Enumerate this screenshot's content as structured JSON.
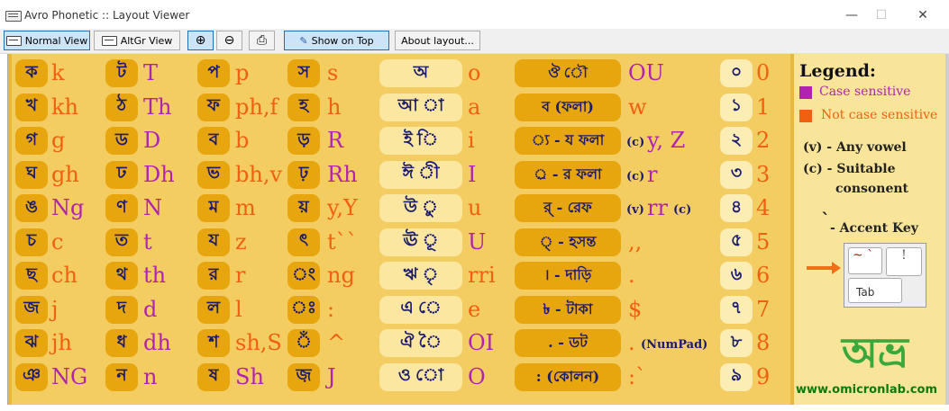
{
  "window": {
    "title": "Avro Phonetic :: Layout Viewer",
    "minimize": "—",
    "maximize": "☐",
    "close": "✕"
  },
  "toolbar": {
    "normal_view": "Normal View",
    "altgr_view": "AltGr View",
    "zoom_in": "⊕",
    "zoom_out": "⊖",
    "print": "⎙",
    "show_on_top": "Show on Top",
    "about": "About layout..."
  },
  "consonants": [
    {
      "bn": "ক",
      "lat": "k",
      "c": "o"
    },
    {
      "bn": "খ",
      "lat": "kh",
      "c": "o"
    },
    {
      "bn": "গ",
      "lat": "g",
      "c": "o"
    },
    {
      "bn": "ঘ",
      "lat": "gh",
      "c": "o"
    },
    {
      "bn": "ঙ",
      "lat": "Ng",
      "c": "p"
    },
    {
      "bn": "চ",
      "lat": "c",
      "c": "o"
    },
    {
      "bn": "ছ",
      "lat": "ch",
      "c": "o"
    },
    {
      "bn": "জ",
      "lat": "j",
      "c": "o"
    },
    {
      "bn": "ঝ",
      "lat": "jh",
      "c": "o"
    },
    {
      "bn": "ঞ",
      "lat": "NG",
      "c": "p"
    }
  ],
  "col2": [
    {
      "bn": "ট",
      "lat": "T",
      "c": "p"
    },
    {
      "bn": "ঠ",
      "lat": "Th",
      "c": "p"
    },
    {
      "bn": "ড",
      "lat": "D",
      "c": "p"
    },
    {
      "bn": "ঢ",
      "lat": "Dh",
      "c": "p"
    },
    {
      "bn": "ণ",
      "lat": "N",
      "c": "p"
    },
    {
      "bn": "ত",
      "lat": "t",
      "c": "p"
    },
    {
      "bn": "থ",
      "lat": "th",
      "c": "p"
    },
    {
      "bn": "দ",
      "lat": "d",
      "c": "p"
    },
    {
      "bn": "ধ",
      "lat": "dh",
      "c": "p"
    },
    {
      "bn": "ন",
      "lat": "n",
      "c": "p"
    }
  ],
  "col3": [
    {
      "bn": "প",
      "lat": "p",
      "c": "o"
    },
    {
      "bn": "ফ",
      "lat": "ph,f",
      "c": "o"
    },
    {
      "bn": "ব",
      "lat": "b",
      "c": "o"
    },
    {
      "bn": "ভ",
      "lat": "bh,v",
      "c": "o"
    },
    {
      "bn": "ম",
      "lat": "m",
      "c": "o"
    },
    {
      "bn": "য",
      "lat": "z",
      "c": "o"
    },
    {
      "bn": "র",
      "lat": "r",
      "c": "o"
    },
    {
      "bn": "ল",
      "lat": "l",
      "c": "o"
    },
    {
      "bn": "শ",
      "lat": "sh,S",
      "c": "o"
    },
    {
      "bn": "ষ",
      "lat": "Sh",
      "c": "p"
    }
  ],
  "col4": [
    {
      "bn": "স",
      "lat": "s",
      "c": "o"
    },
    {
      "bn": "হ",
      "lat": "h",
      "c": "o"
    },
    {
      "bn": "ড়",
      "lat": "R",
      "c": "p"
    },
    {
      "bn": "ঢ়",
      "lat": "Rh",
      "c": "p"
    },
    {
      "bn": "য়",
      "lat": "y,Y",
      "c": "o"
    },
    {
      "bn": "ৎ",
      "lat": "t``",
      "c": "o"
    },
    {
      "bn": "ং",
      "lat": "ng",
      "c": "o"
    },
    {
      "bn": "ঃ",
      "lat": ":",
      "c": "o"
    },
    {
      "bn": "ঁ",
      "lat": "^",
      "c": "o"
    },
    {
      "bn": "জ়",
      "lat": "J",
      "c": "p"
    }
  ],
  "vowels": [
    {
      "bn": "অ",
      "lat": "o",
      "c": "o"
    },
    {
      "bn": "আ  া",
      "lat": "a",
      "c": "o"
    },
    {
      "bn": "ই  ি",
      "lat": "i",
      "c": "o"
    },
    {
      "bn": "ঈ  ী",
      "lat": "I",
      "c": "p"
    },
    {
      "bn": "উ  ু",
      "lat": "u",
      "c": "o"
    },
    {
      "bn": "ঊ  ূ",
      "lat": "U",
      "c": "p"
    },
    {
      "bn": "ঋ  ৃ",
      "lat": "rri",
      "c": "o"
    },
    {
      "bn": "এ  ে",
      "lat": "e",
      "c": "o"
    },
    {
      "bn": "ঐ  ৈ",
      "lat": "OI",
      "c": "p"
    },
    {
      "bn": "ও  ো",
      "lat": "O",
      "c": "p"
    }
  ],
  "signs": [
    {
      "bn": "ঔ  ৌ",
      "lat": "OU",
      "c": "p",
      "pre": ""
    },
    {
      "bn": "ব (ফলা)",
      "lat": "w",
      "c": "o",
      "pre": ""
    },
    {
      "bn": "্য - য ফলা",
      "lat": "y, Z",
      "c": "p",
      "pre": "(c)"
    },
    {
      "bn": "্র - র ফলা",
      "lat": "r",
      "c": "p",
      "pre": "(c)"
    },
    {
      "bn": "র্ - রেফ",
      "lat": "rr",
      "c": "p",
      "pre": "(v)",
      "post": "(c)"
    },
    {
      "bn": "্ - হসন্ত",
      "lat": ",,",
      "c": "o",
      "pre": ""
    },
    {
      "bn": "। - দাড়ি",
      "lat": ".",
      "c": "o",
      "pre": ""
    },
    {
      "bn": "৳ - টাকা",
      "lat": "$",
      "c": "o",
      "pre": ""
    },
    {
      "bn": ". - ডট",
      "lat": ".",
      "c": "o",
      "pre": "",
      "post": "(NumPad)"
    },
    {
      "bn": ": (কোলন)",
      "lat": ":`",
      "c": "o",
      "pre": ""
    }
  ],
  "digits": [
    {
      "bn": "০",
      "lat": "0"
    },
    {
      "bn": "১",
      "lat": "1"
    },
    {
      "bn": "২",
      "lat": "2"
    },
    {
      "bn": "৩",
      "lat": "3"
    },
    {
      "bn": "৪",
      "lat": "4"
    },
    {
      "bn": "৫",
      "lat": "5"
    },
    {
      "bn": "৬",
      "lat": "6"
    },
    {
      "bn": "৭",
      "lat": "7"
    },
    {
      "bn": "৮",
      "lat": "8"
    },
    {
      "bn": "৯",
      "lat": "9"
    }
  ],
  "legend": {
    "title": "Legend:",
    "case_sensitive": "Case sensitive",
    "not_case_sensitive": "Not case sensitive",
    "any_vowel": "(v) - Any vowel",
    "suitable": "(c) - Suitable",
    "consonant": "consonent",
    "accent_mark": "`",
    "accent_key": "- Accent Key",
    "key_tilde": "~",
    "key_backtick": "`",
    "key_one": "!",
    "key_tab": "Tab",
    "logo_text": "অভ্র",
    "site": "www.omicronlab.com",
    "colors": {
      "case_sensitive": "#b023b0",
      "not_case_sensitive": "#f06010"
    }
  }
}
